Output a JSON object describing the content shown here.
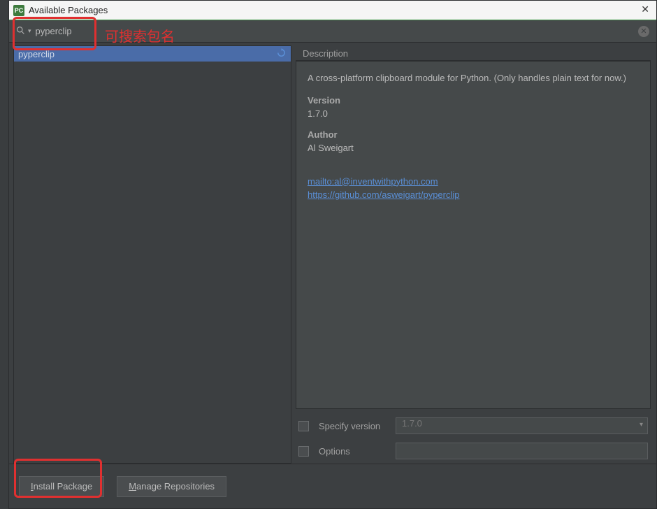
{
  "window": {
    "title": "Available Packages",
    "app_icon_label": "PC"
  },
  "search": {
    "value": "pyperclip"
  },
  "annotation": {
    "search_hint": "可搜索包名"
  },
  "package_list": {
    "selected": "pyperclip"
  },
  "description": {
    "header": "Description",
    "text": "A cross-platform clipboard module for Python. (Only handles plain text for now.)",
    "version_label": "Version",
    "version_value": "1.7.0",
    "author_label": "Author",
    "author_value": "Al Sweigart",
    "link_email": "mailto:al@inventwithpython.com",
    "link_repo": "https://github.com/asweigart/pyperclip"
  },
  "options": {
    "specify_version_label": "Specify version",
    "specify_version_value": "1.7.0",
    "options_label": "Options",
    "options_value": ""
  },
  "buttons": {
    "install": "Install Package",
    "manage": "Manage Repositories"
  }
}
